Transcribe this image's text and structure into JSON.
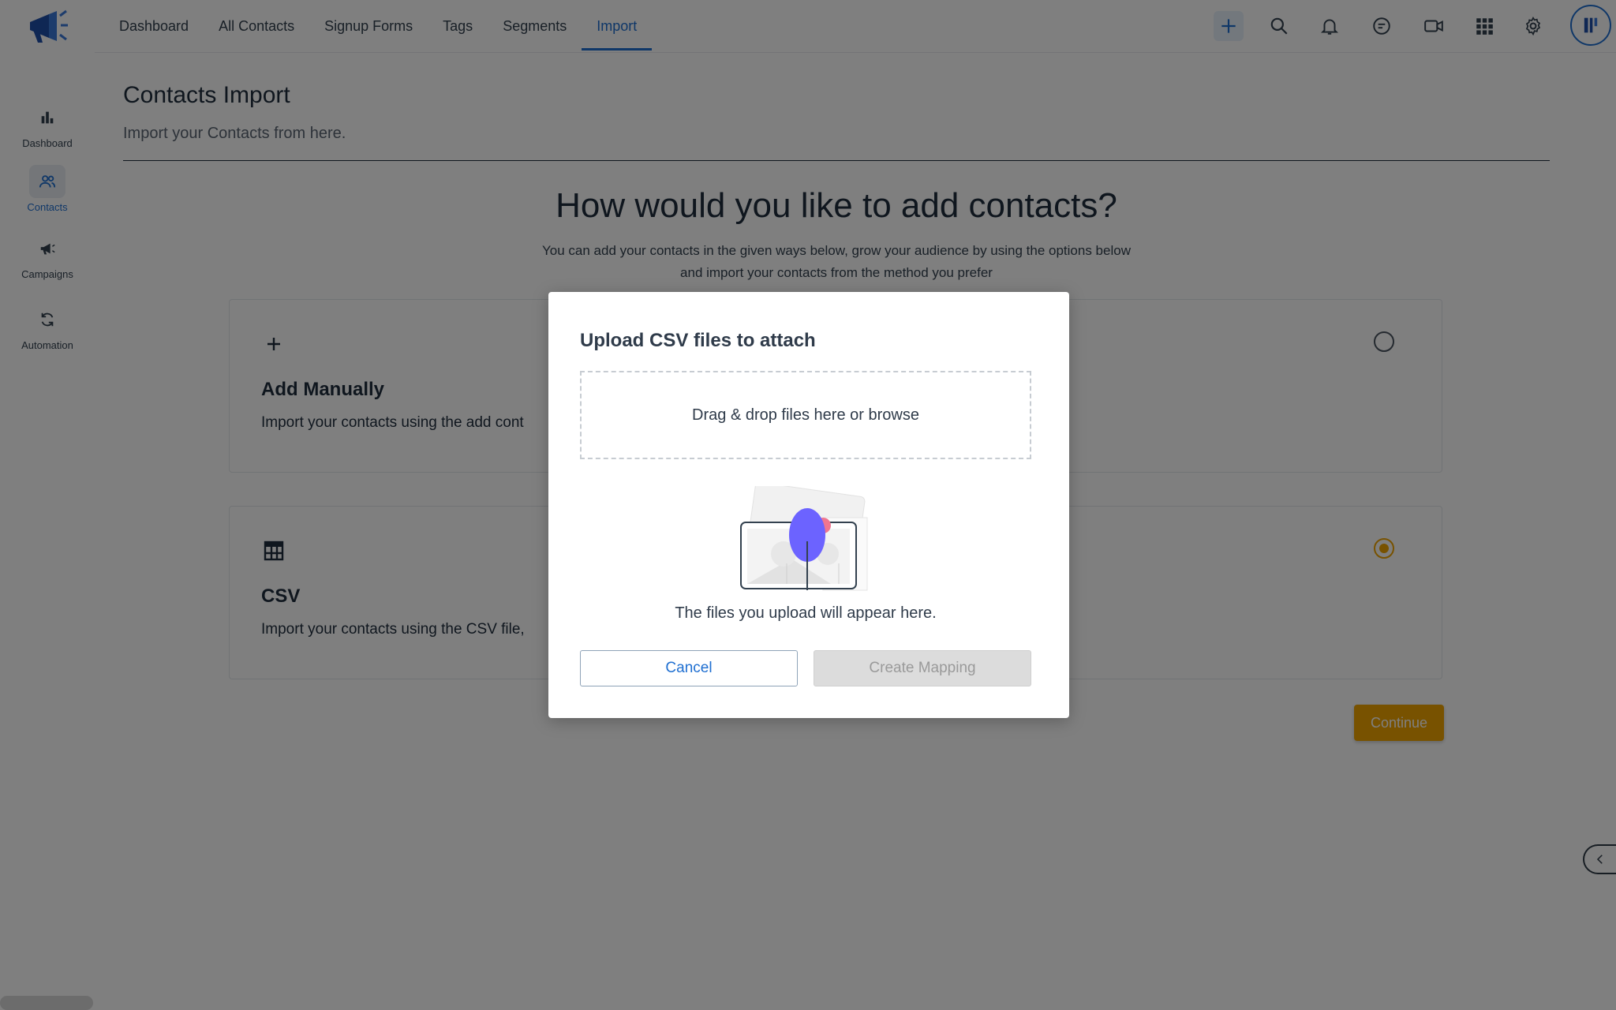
{
  "topnav": {
    "items": [
      {
        "label": "Dashboard",
        "active": false
      },
      {
        "label": "All Contacts",
        "active": false
      },
      {
        "label": "Signup Forms",
        "active": false
      },
      {
        "label": "Tags",
        "active": false
      },
      {
        "label": "Segments",
        "active": false
      },
      {
        "label": "Import",
        "active": true
      }
    ],
    "tools": [
      "plus-icon",
      "search-icon",
      "bell-icon",
      "chat-icon",
      "video-icon",
      "apps-grid-icon",
      "gear-icon"
    ],
    "accent_color": "#1f6fd1"
  },
  "sidebar": {
    "items": [
      {
        "label": "Dashboard",
        "icon": "bar-chart-icon",
        "active": false
      },
      {
        "label": "Contacts",
        "icon": "contacts-icon",
        "active": true
      },
      {
        "label": "Campaigns",
        "icon": "megaphone-icon",
        "active": false
      },
      {
        "label": "Automation",
        "icon": "refresh-icon",
        "active": false
      }
    ]
  },
  "page": {
    "title": "Contacts Import",
    "subtitle": "Import your Contacts from here.",
    "headline": "How would you like to add contacts?",
    "description": "You can add your contacts in the given ways below, grow your audience by using the options below and import your contacts from the method you prefer"
  },
  "options": [
    {
      "title": "Add Manually",
      "description": "Import your contacts using the add cont",
      "icon": "plus-icon",
      "selected": false
    },
    {
      "title": "CSV",
      "description": "Import your contacts using the CSV file,",
      "icon": "table-icon",
      "selected": true
    }
  ],
  "continue_label": "Continue",
  "continue_color": "#f0a500",
  "modal": {
    "title": "Upload CSV files to attach",
    "dropzone_text": "Drag & drop files here or browse",
    "empty_text": "The files you upload will appear here.",
    "cancel_label": "Cancel",
    "create_label": "Create Mapping"
  }
}
